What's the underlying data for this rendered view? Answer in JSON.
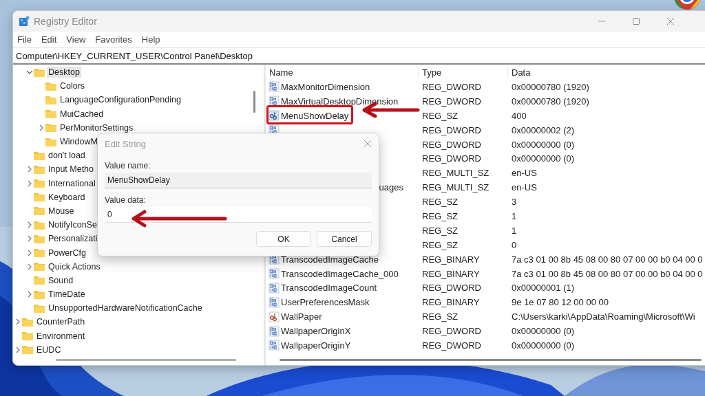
{
  "window": {
    "title": "Registry Editor"
  },
  "menu": [
    "File",
    "Edit",
    "View",
    "Favorites",
    "Help"
  ],
  "address": "Computer\\HKEY_CURRENT_USER\\Control Panel\\Desktop",
  "tree": [
    {
      "children": [
        {
          "label": "Desktop",
          "kind": "branch",
          "expanded": true,
          "selected": true,
          "children": [
            {
              "label": "Colors",
              "kind": "leaf",
              "selected": false
            },
            {
              "label": "LanguageConfigurationPending",
              "kind": "leaf",
              "selected": false
            },
            {
              "label": "MuiCached",
              "kind": "leaf",
              "selected": false
            },
            {
              "label": "PerMonitorSettings",
              "kind": "branch",
              "expanded": false,
              "selected": false
            },
            {
              "label": "WindowM",
              "kind": "leaf",
              "selected": false
            }
          ]
        },
        {
          "label": "don't load",
          "kind": "leaf",
          "selected": false
        },
        {
          "label": "Input Metho",
          "kind": "branch",
          "expanded": false,
          "selected": false
        },
        {
          "label": "International",
          "kind": "branch",
          "expanded": false,
          "selected": false
        },
        {
          "label": "Keyboard",
          "kind": "leaf",
          "selected": false
        },
        {
          "label": "Mouse",
          "kind": "leaf",
          "selected": false
        },
        {
          "label": "NotifyIconSe",
          "kind": "branch",
          "expanded": false,
          "selected": false
        },
        {
          "label": "Personalizati",
          "kind": "branch",
          "expanded": false,
          "selected": false
        },
        {
          "label": "PowerCfg",
          "kind": "branch",
          "expanded": false,
          "selected": false
        },
        {
          "label": "Quick Actions",
          "kind": "branch",
          "expanded": false,
          "selected": false
        },
        {
          "label": "Sound",
          "kind": "leaf",
          "selected": false
        },
        {
          "label": "TimeDate",
          "kind": "branch",
          "expanded": false,
          "selected": false
        },
        {
          "label": "UnsupportedHardwareNotificationCache",
          "kind": "leaf",
          "selected": false
        }
      ]
    },
    {
      "label": "CounterPath",
      "kind": "branch",
      "expanded": false,
      "selected": false
    },
    {
      "label": "Environment",
      "kind": "leaf",
      "selected": false
    },
    {
      "label": "EUDC",
      "kind": "branch",
      "expanded": false,
      "selected": false
    }
  ],
  "table": {
    "columns": [
      "Name",
      "Type",
      "Data"
    ],
    "rows": [
      {
        "kind": "binary",
        "name": "MaxMonitorDimension",
        "type": "REG_DWORD",
        "data": "0x00000780 (1920)"
      },
      {
        "kind": "binary",
        "name": "MaxVirtualDesktopDimension",
        "type": "REG_DWORD",
        "data": "0x00000780 (1920)"
      },
      {
        "kind": "string",
        "name": "MenuShowDelay",
        "type": "REG_SZ",
        "data": "400"
      },
      {
        "kind": "binary",
        "type": "REG_DWORD",
        "data": "0x00000002 (2)"
      },
      {
        "type": "REG_DWORD",
        "data": "0x00000000 (0)"
      },
      {
        "type": "REG_DWORD",
        "data": "0x00000000 (0)"
      },
      {
        "type": "REG_MULTI_SZ",
        "data": "en-US"
      },
      {
        "name_tail": "uages",
        "type": "REG_MULTI_SZ",
        "data": "en-US"
      },
      {
        "type": "REG_SZ",
        "data": "3"
      },
      {
        "type": "REG_SZ",
        "data": "1"
      },
      {
        "type": "REG_SZ",
        "data": "1"
      },
      {
        "type": "REG_SZ",
        "data": "0"
      },
      {
        "kind": "binary",
        "name": "TranscodedImageCache",
        "type": "REG_BINARY",
        "data": "7a c3 01 00 8b 45 08 00 80 07 00 00 b0 04 00 0"
      },
      {
        "kind": "binary",
        "name": "TranscodedImageCache_000",
        "type": "REG_BINARY",
        "data": "7a c3 01 00 8b 45 08 00 80 07 00 00 b0 04 00 0"
      },
      {
        "kind": "binary",
        "name": "TranscodedImageCount",
        "type": "REG_DWORD",
        "data": "0x00000001 (1)"
      },
      {
        "kind": "binary",
        "name": "UserPreferencesMask",
        "type": "REG_BINARY",
        "data": "9e 1e 07 80 12 00 00 00"
      },
      {
        "kind": "wallpaper",
        "name": "WallPaper",
        "type": "REG_SZ",
        "data": "C:\\Users\\karki\\AppData\\Roaming\\Microsoft\\Wi"
      },
      {
        "kind": "binary",
        "name": "WallpaperOriginX",
        "type": "REG_DWORD",
        "data": "0x00000000 (0)"
      },
      {
        "kind": "binary",
        "name": "WallpaperOriginY",
        "type": "REG_DWORD",
        "data": "0x00000000 (0)"
      }
    ]
  },
  "dialog": {
    "title": "Edit String",
    "name_label": "Value name:",
    "name_value": "MenuShowDelay",
    "data_label": "Value data:",
    "data_value": "0",
    "buttons": [
      "OK",
      "Cancel"
    ]
  }
}
